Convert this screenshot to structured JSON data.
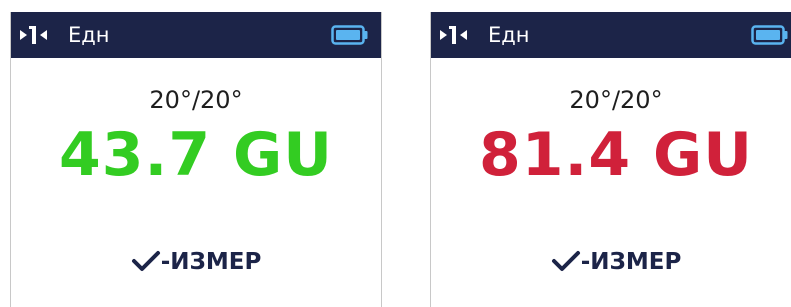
{
  "colors": {
    "header_bg": "#1c2448",
    "battery": "#5ab4f0",
    "reading_ok": "#33cc22",
    "reading_high": "#d0213a"
  },
  "screens": [
    {
      "header": {
        "mode_icon": "mode-icon",
        "unit_label": "Едн",
        "battery_icon": "battery-icon"
      },
      "angle": "20°/20°",
      "reading": "43.7 GU",
      "reading_color": "#33cc22",
      "measure_icon": "check-icon",
      "measure_label": "-ИЗМЕР"
    },
    {
      "header": {
        "mode_icon": "mode-icon",
        "unit_label": "Едн",
        "battery_icon": "battery-icon"
      },
      "angle": "20°/20°",
      "reading": "81.4 GU",
      "reading_color": "#d0213a",
      "measure_icon": "check-icon",
      "measure_label": "-ИЗМЕР"
    }
  ]
}
